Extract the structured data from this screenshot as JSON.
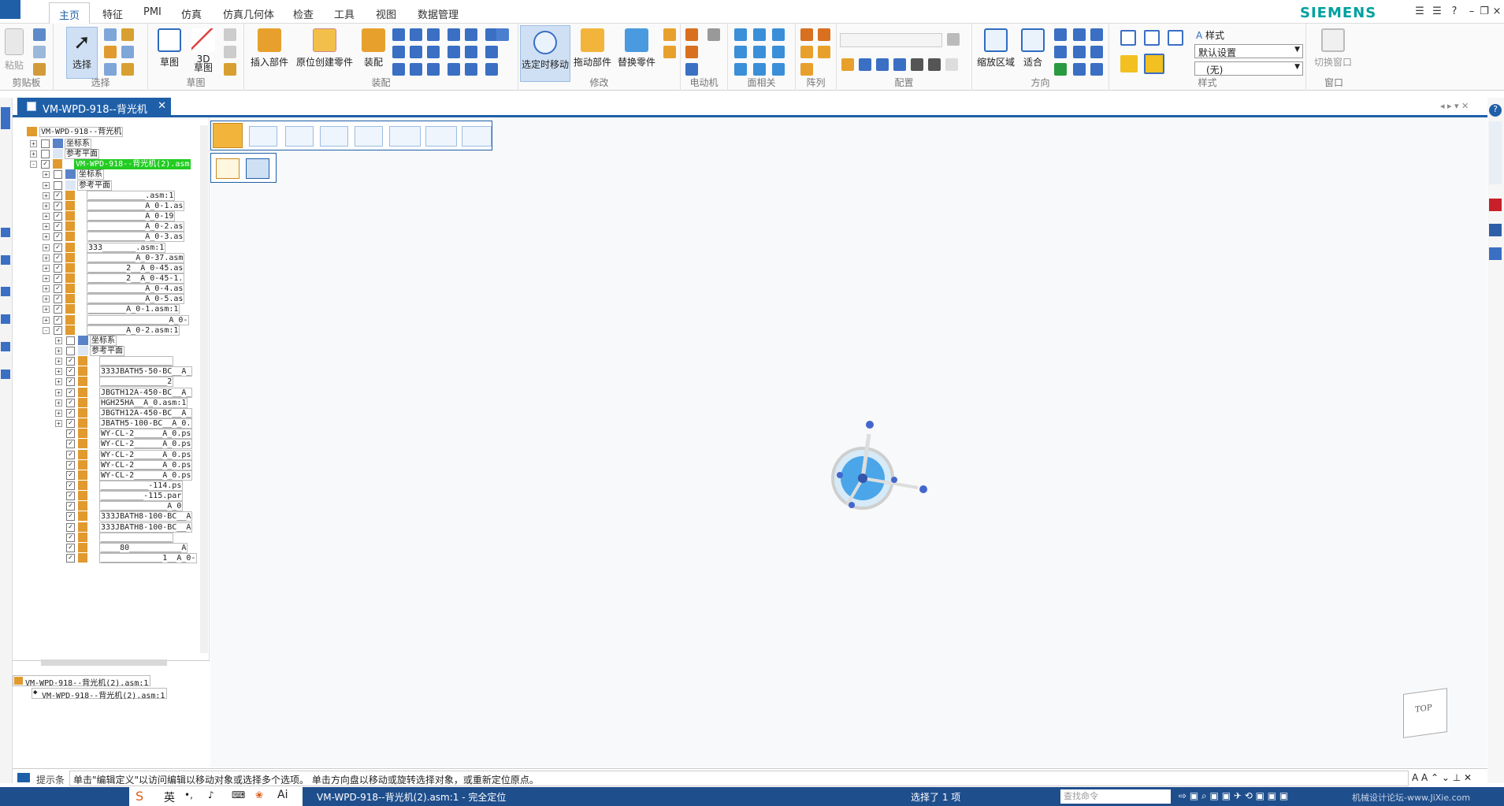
{
  "menu_tabs": [
    "主页",
    "特征",
    "PMI",
    "仿真",
    "仿真几何体",
    "检查",
    "工具",
    "视图",
    "数据管理"
  ],
  "brand": "SIEMENS",
  "ribbon": {
    "clipboard": {
      "paste": "粘贴",
      "group": "剪贴板"
    },
    "select": {
      "select": "选择",
      "group": "选择"
    },
    "sketch": {
      "sketch": "草图",
      "sketch3d": "3D\n草图",
      "group": "草图"
    },
    "assemble": {
      "insert": "插入部件",
      "inplace": "原位创建零件",
      "assemble": "装配",
      "group": "装配"
    },
    "modify": {
      "move": "选定时移动",
      "drag": "拖动部件",
      "replace": "替换零件",
      "group": "修改"
    },
    "motor": {
      "group": "电动机"
    },
    "relate": {
      "group": "面相关"
    },
    "pattern": {
      "group": "阵列"
    },
    "config": {
      "group": "配置"
    },
    "orient": {
      "zoom_area": "缩放区域",
      "fit": "适合",
      "group": "方向"
    },
    "style": {
      "label": "样式",
      "default": "默认设置",
      "none": "(无)",
      "group": "样式"
    },
    "window": {
      "switch": "切换窗口",
      "group": "窗口"
    }
  },
  "doc_tab": "VM-WPD-918--背光机",
  "tree": {
    "root": "VM-WPD-918--背光机",
    "rows": [
      {
        "t": "坐标系"
      },
      {
        "t": "参考平面"
      },
      {
        "t": "VM-WPD-918--背光机(2).asm"
      },
      {
        "t": "坐标系"
      },
      {
        "t": "参考平面"
      },
      {
        "t": "____________.asm:1"
      },
      {
        "t": "____________A_0-1.as"
      },
      {
        "t": "____________A_0-19"
      },
      {
        "t": "____________A_0-2.as"
      },
      {
        "t": "____________A_0-3.as"
      },
      {
        "t": "333_______.asm:1"
      },
      {
        "t": "__________A_0-37.asm"
      },
      {
        "t": "________2__A_0-45.as"
      },
      {
        "t": "________2__A_0-45-1."
      },
      {
        "t": "____________A_0-4.as"
      },
      {
        "t": "____________A_0-5.as"
      },
      {
        "t": "________A_0-1.asm:1"
      },
      {
        "t": "_________________A_0-"
      },
      {
        "t": "________A_0-2.asm:1"
      },
      {
        "t": "坐标系"
      },
      {
        "t": "参考平面"
      },
      {
        "t": "_______________"
      },
      {
        "t": "333JBATH5-50-BC__A_"
      },
      {
        "t": "______________2"
      },
      {
        "t": "JBGTH12A-450-BC__A_"
      },
      {
        "t": "HGH25HA__A_0.asm:1"
      },
      {
        "t": "JBGTH12A-450-BC__A_"
      },
      {
        "t": "JBATH5-100-BC__A_0."
      },
      {
        "t": "WY-CL-2______A_0.ps"
      },
      {
        "t": "WY-CL-2______A_0.ps"
      },
      {
        "t": "WY-CL-2______A_0.ps"
      },
      {
        "t": "WY-CL-2______A_0.ps"
      },
      {
        "t": "WY-CL-2______A_0.ps"
      },
      {
        "t": "__________-114.ps"
      },
      {
        "t": "_________-115.par"
      },
      {
        "t": "______________A_0"
      },
      {
        "t": "333JBATH8-100-BC__A"
      },
      {
        "t": "333JBATH8-100-BC__A"
      },
      {
        "t": "_______________"
      },
      {
        "t": "____80___________A"
      },
      {
        "t": "_____________1__A_0-"
      }
    ],
    "footer1": "VM-WPD-918--背光机(2).asm:1",
    "footer2": "VM-WPD-918--背光机(2).asm:1"
  },
  "prompt": {
    "label": "提示条",
    "text": "单击\"编辑定义\"以访问编辑以移动对象或选择多个选项。 单击方向盘以移动或旋转选择对象，或重新定位原点。",
    "search_placeholder": "查找命令"
  },
  "status": {
    "doc": "VM-WPD-918--背光机(2).asm:1 - 完全定位",
    "sel": "选择了 1 项",
    "ime": "英",
    "watermark": "机械设计论坛-www.JiXie.com"
  },
  "viewcube": "TOP",
  "colors": {
    "accent": "#1f5fa8",
    "selected": "#22cc22"
  }
}
